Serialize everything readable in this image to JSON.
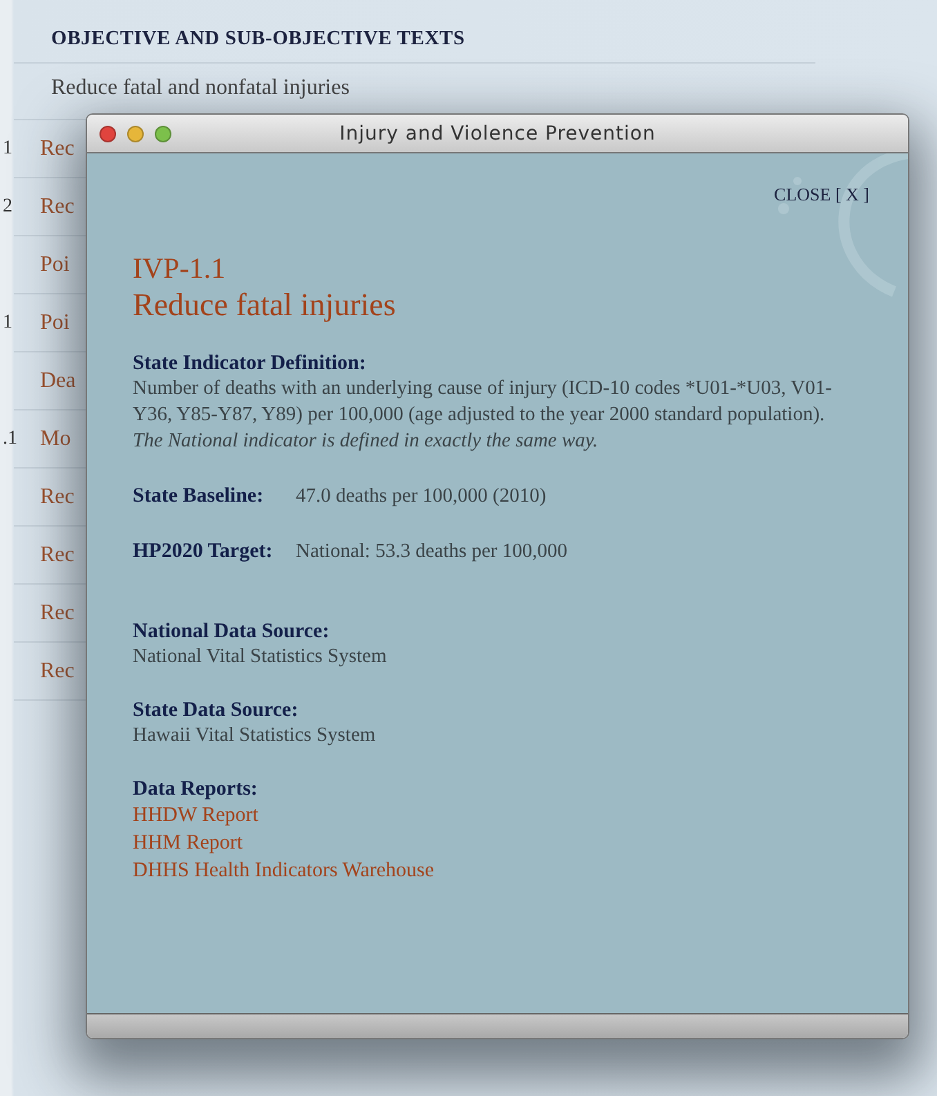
{
  "page": {
    "heading": "OBJECTIVE AND SUB-OBJECTIVE TEXTS",
    "intro": "Reduce fatal and nonfatal injuries",
    "rows": [
      {
        "num": "1",
        "text": "Rec"
      },
      {
        "num": "2",
        "text": "Rec"
      },
      {
        "text": "Poi"
      },
      {
        "num": "1",
        "text": "Poi"
      },
      {
        "text": "Dea"
      },
      {
        "num": ".1",
        "text": "Mo"
      },
      {
        "text": "Rec"
      },
      {
        "text": "Rec"
      },
      {
        "text": "Rec"
      },
      {
        "text": "Rec"
      }
    ]
  },
  "window": {
    "title": "Injury and Violence Prevention",
    "close": "CLOSE [ X ]",
    "code": "IVP-1.1",
    "name": "Reduce fatal injuries",
    "definition": {
      "label": "State Indicator Definition:",
      "text": "Number of deaths with an underlying cause of injury (ICD-10 codes *U01-*U03, V01-Y36, Y85-Y87, Y89) per 100,000 (age adjusted to the year 2000 standard population). *The National indicator is defined in exactly the same way.*"
    },
    "fields": [
      {
        "label": "State Baseline:",
        "value": "47.0 deaths per 100,000 (2010)"
      },
      {
        "label": "HP2020 Target:",
        "value": "National: 53.3 deaths per 100,000"
      }
    ],
    "sources": [
      {
        "label": "National Data Source:",
        "value": "National Vital Statistics System"
      },
      {
        "label": "State Data Source:",
        "value": "Hawaii Vital Statistics System"
      }
    ],
    "reports": {
      "label": "Data Reports:",
      "links": [
        "HHDW Report",
        "HHM Report",
        "DHHS Health Indicators Warehouse"
      ]
    }
  }
}
